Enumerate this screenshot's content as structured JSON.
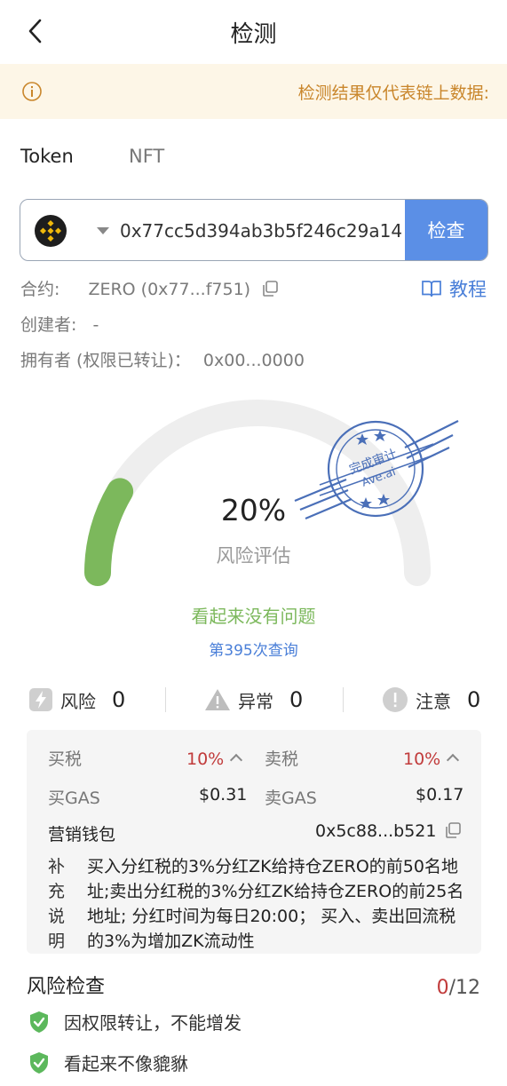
{
  "header": {
    "title": "检测"
  },
  "notice": {
    "text": "检测结果仅代表链上数据:"
  },
  "tabs": [
    "Token",
    "NFT"
  ],
  "search": {
    "value": "0x77cc5d394ab3b5f246c29a14",
    "button_label": "检查"
  },
  "contract": {
    "label": "合约:",
    "value": "ZERO (0x77...f751)",
    "tutorial_label": "教程"
  },
  "creator": {
    "label": "创建者:",
    "value": "-"
  },
  "owner": {
    "label": "拥有者 (权限已转让)：",
    "value": "0x00...0000"
  },
  "risk_score": {
    "percent_text": "20%",
    "percent": 20,
    "label": "风险评估",
    "status": "看起来没有问题",
    "query_count": "第395次查询"
  },
  "stamp": {
    "line1": "完成审计",
    "line2": "Ave.ai"
  },
  "counts": [
    {
      "label": "风险",
      "value": "0",
      "icon": "lightning-icon"
    },
    {
      "label": "异常",
      "value": "0",
      "icon": "warning-triangle-icon"
    },
    {
      "label": "注意",
      "value": "0",
      "icon": "exclamation-circle-icon"
    }
  ],
  "tax": {
    "buy_tax_label": "买税",
    "buy_tax_value": "10%",
    "sell_tax_label": "卖税",
    "sell_tax_value": "10%",
    "buy_gas_label": "买GAS",
    "buy_gas_value": "$0.31",
    "sell_gas_label": "卖GAS",
    "sell_gas_value": "$0.17",
    "wallet_label": "营销钱包",
    "wallet_value": "0x5c88...b521",
    "supplement_label": "补充说明",
    "supplement_text": "买入分红税的3%分红ZK给持仓ZERO的前50名地址;卖出分红税的3%分红ZK给持仓ZERO的前25名地址; 分红时间为每日20:00； 买入、卖出回流税的3%为增加ZK流动性"
  },
  "risk_check": {
    "title": "风险检查",
    "passed_text": "0",
    "total_text": "/12",
    "items": [
      "因权限转让，不能增发",
      "看起来不像貔貅"
    ]
  },
  "colors": {
    "accent_blue": "#5b8fe6",
    "gauge_green": "#7cb85c",
    "warning_orange": "#c9862b",
    "risk_red": "#c13b3b"
  }
}
